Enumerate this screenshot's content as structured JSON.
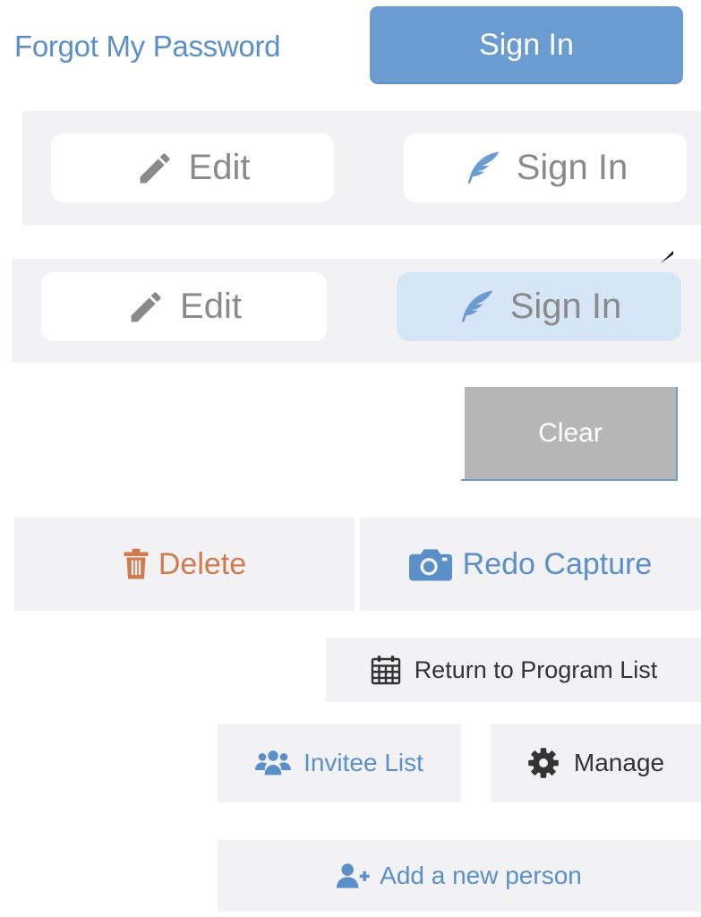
{
  "auth": {
    "forgot_password_label": "Forgot My Password",
    "sign_in_label": "Sign In"
  },
  "panel_1": {
    "edit_label": "Edit",
    "sign_in_label": "Sign In"
  },
  "panel_2": {
    "edit_label": "Edit",
    "sign_in_label": "Sign In",
    "sign_in_state": "active"
  },
  "clear": {
    "label": "Clear"
  },
  "capture_actions": {
    "delete_label": "Delete",
    "redo_label": "Redo Capture"
  },
  "navigation": {
    "return_label": "Return to Program List"
  },
  "people": {
    "invitee_label": "Invitee List",
    "manage_label": "Manage",
    "add_person_label": "Add a new person"
  },
  "icons": {
    "edit": "pencil-icon",
    "sign_in": "feather-icon",
    "delete": "trash-icon",
    "redo": "camera-icon",
    "return": "calendar-icon",
    "invitee": "users-icon",
    "manage": "gear-icon",
    "add_person": "user-plus-icon"
  },
  "colors": {
    "primary": "#6a9bd1",
    "link": "#5b8fc7",
    "danger": "#d27a4d",
    "panel_bg": "#f2f2f4",
    "active_pill": "#d6e6f6",
    "clear_bg": "#b6b6b6",
    "muted_text": "#8a8a8a"
  }
}
